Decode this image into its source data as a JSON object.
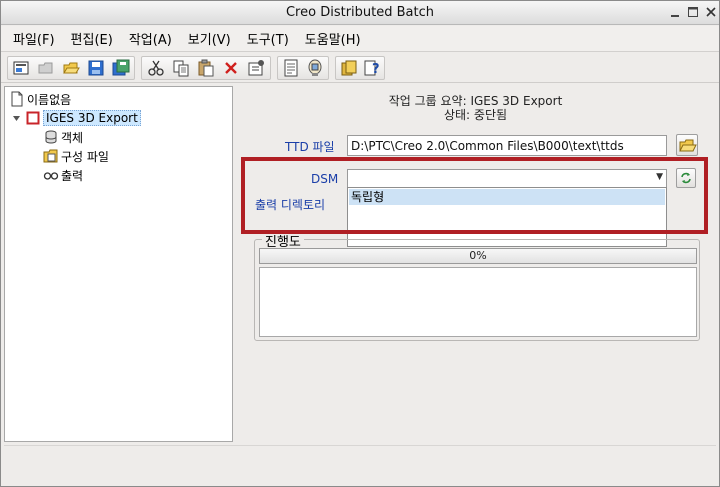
{
  "window": {
    "title": "Creo Distributed Batch"
  },
  "menu": {
    "items": [
      "파일(F)",
      "편집(E)",
      "작업(A)",
      "보기(V)",
      "도구(T)",
      "도움말(H)"
    ]
  },
  "toolbar": {
    "icons": [
      "new-icon",
      "open-disabled-icon",
      "open-folder-icon",
      "save-icon",
      "save-as-icon",
      "cut-icon",
      "copy-icon",
      "paste-icon",
      "delete-icon",
      "properties-icon",
      "document-icon",
      "monitor-icon",
      "db-icon",
      "help-icon"
    ]
  },
  "tree": {
    "root": "이름없음",
    "task": "IGES 3D Export",
    "children": [
      "객체",
      "구성 파일",
      "출력"
    ]
  },
  "summary": {
    "line1": "작업 그룹 요약: IGES 3D Export",
    "line2": "상태: 중단됨"
  },
  "form": {
    "ttd_label": "TTD 파일",
    "ttd_value": "D:\\PTC\\Creo 2.0\\Common Files\\B000\\text\\ttds",
    "dsm_label": "DSM",
    "dsm_value": "",
    "dsm_options": [
      "독립형"
    ],
    "output_label": "출력 디렉토리"
  },
  "progress": {
    "title": "진행도",
    "percent": 0,
    "label": "0%"
  },
  "colors": {
    "highlight": "#b01f24",
    "label_blue": "#1a3ea8",
    "selection": "#cde8ff"
  }
}
